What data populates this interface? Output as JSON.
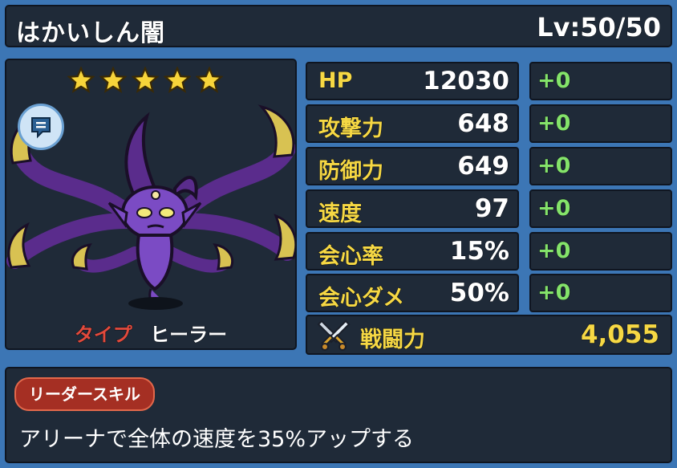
{
  "unit": {
    "name": "はかいしん闇",
    "level_text": "Lv:50/50",
    "rarity_stars": 5,
    "type_label": "タイプ",
    "type_value": "ヒーラー"
  },
  "stats": [
    {
      "label": "HP",
      "value": "12030",
      "bonus": "+0"
    },
    {
      "label": "攻撃力",
      "value": "648",
      "bonus": "+0"
    },
    {
      "label": "防御力",
      "value": "649",
      "bonus": "+0"
    },
    {
      "label": "速度",
      "value": "97",
      "bonus": "+0"
    },
    {
      "label": "会心率",
      "value": "15%",
      "bonus": "+0"
    },
    {
      "label": "会心ダメ",
      "value": "50%",
      "bonus": "+0"
    }
  ],
  "power": {
    "label": "戦闘力",
    "value": "4,055"
  },
  "leader_skill": {
    "badge": "リーダースキル",
    "description": "アリーナで全体の速度を35%アップする"
  },
  "icons": {
    "star": "star-icon",
    "chat": "speech-bubble-icon",
    "swords": "crossed-swords-icon",
    "character": "monster-portrait"
  },
  "colors": {
    "background": "#3c76b5",
    "panel": "#1f2a38",
    "stat_label": "#f6d844",
    "bonus": "#84e36a",
    "type_label": "#e24a3c"
  }
}
